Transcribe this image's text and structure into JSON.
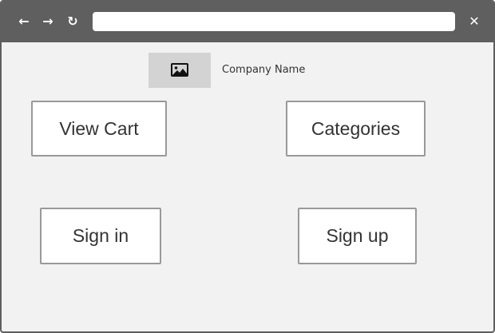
{
  "browser": {
    "back_icon": "←",
    "forward_icon": "→",
    "reload_icon": "↻",
    "close_icon": "✕",
    "address_value": "",
    "toolbar_color": "#5f5f5f"
  },
  "header": {
    "logo_icon": "image-icon",
    "company_name": "Company Name"
  },
  "buttons": {
    "view_cart": "View Cart",
    "categories": "Categories",
    "sign_in": "Sign in",
    "sign_up": "Sign up"
  }
}
